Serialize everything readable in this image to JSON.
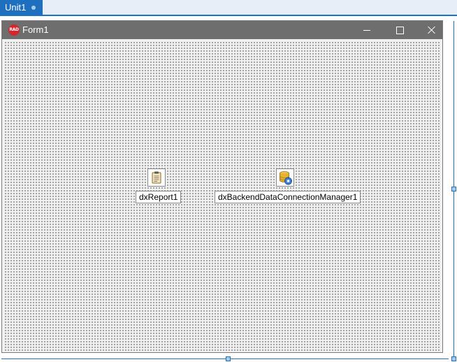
{
  "tab": {
    "label": "Unit1"
  },
  "form": {
    "title": "Form1",
    "icon_text": "RAD",
    "buttons": [
      "minimize-icon",
      "maximize-icon",
      "close-icon"
    ]
  },
  "components": [
    {
      "name": "dxReport1",
      "icon": "report-clipboard-icon"
    },
    {
      "name": "dxBackendDataConnectionManager1",
      "icon": "database-gear-icon"
    }
  ],
  "colors": {
    "tab_active": "#1f6fbf",
    "titlebar": "#6e6e6e",
    "canvas": "#f0f0f0",
    "rad_logo": "#d6262b"
  }
}
